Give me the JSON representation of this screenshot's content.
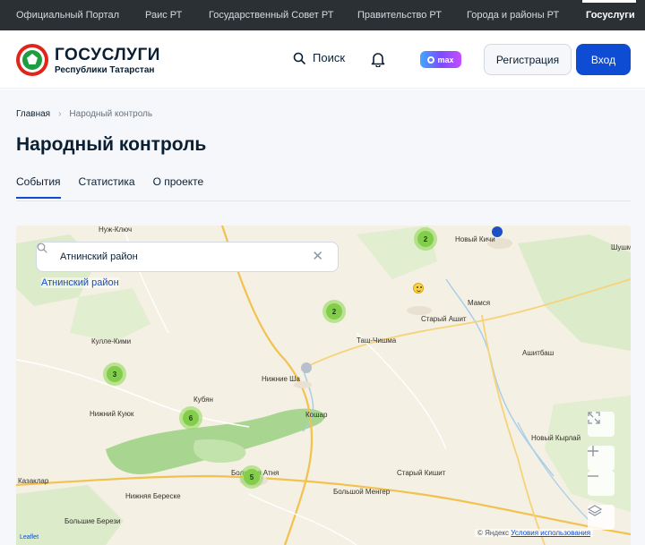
{
  "topnav": {
    "items": [
      "Официальный Портал",
      "Раис РТ",
      "Государственный Совет РТ",
      "Правительство РТ",
      "Города и районы РТ",
      "Госуслуги"
    ],
    "active": "Госуслуги"
  },
  "header": {
    "brand_title": "ГОСУСЛУГИ",
    "brand_sub": "Республики Татарстан",
    "search_label": "Поиск",
    "max_label": "max",
    "register_label": "Регистрация",
    "login_label": "Вход"
  },
  "breadcrumb": {
    "home": "Главная",
    "separator": "›",
    "current": "Народный контроль"
  },
  "page_title": "Народный контроль",
  "tabs": [
    {
      "label": "События",
      "active": true
    },
    {
      "label": "Статистика",
      "active": false
    },
    {
      "label": "О проекте",
      "active": false
    }
  ],
  "map": {
    "search_value": "Атнинский район",
    "suggestion": "Атнинский район",
    "places": [
      "Нуж-Ключ",
      "Новый Кичи",
      "Шушм",
      "Мамся",
      "Старый Ашит",
      "Таш-Чишма",
      "Ашитбаш",
      "Кулле-Кими",
      "Нижние Ша",
      "Кубян",
      "Нижний Куюк",
      "Кошар",
      "Новый Кырлай",
      "Казаклар",
      "Большая Атня",
      "Старый Кишит",
      "Большой Менгер",
      "Нижняя Береске",
      "Большие Берези"
    ],
    "clusters": [
      "2",
      "2",
      "3",
      "6",
      "5"
    ],
    "attribution_provider": "© Яндекс",
    "attribution_link": "Условия использования",
    "leaflet": "Leaflet"
  },
  "colors": {
    "topbar": "#2b3035",
    "primary": "#0d4cd3",
    "cluster": "#82cd4a",
    "logo_red": "#e1251b",
    "logo_green": "#1d9e40"
  }
}
